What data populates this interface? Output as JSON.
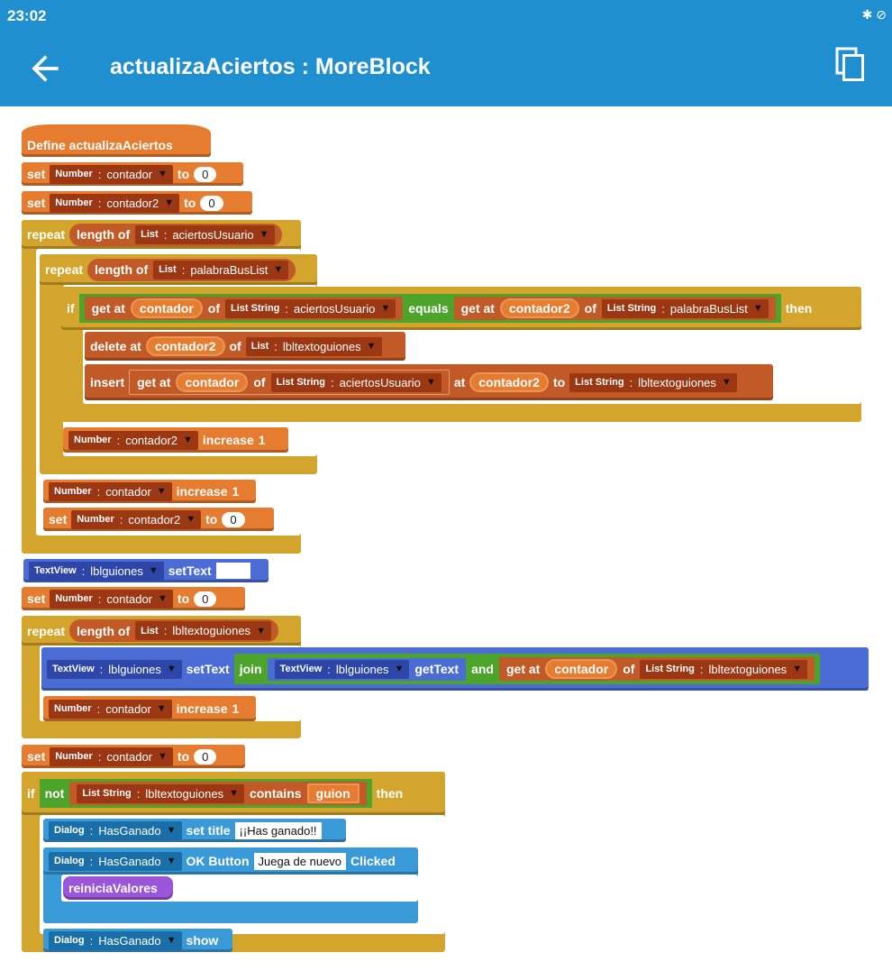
{
  "status": {
    "time": "23:02"
  },
  "appbar": {
    "title": "actualizaAciertos : MoreBlock",
    "back_icon": "arrow-left-icon",
    "copy_icon": "copy-icon"
  },
  "kw": {
    "define": "Define actualizaAciertos",
    "set": "set",
    "to": "to",
    "repeat": "repeat",
    "if": "if",
    "then": "then",
    "length_of": "length of",
    "get_at": "get at",
    "of": "of",
    "equals": "equals",
    "delete_at": "delete at",
    "insert": "insert",
    "at": "at",
    "increase": "increase",
    "set_text": "setText",
    "join": "join",
    "get_text": "getText",
    "and": "and",
    "not": "not",
    "contains": "contains",
    "set_title": "set title",
    "ok_button": "OK Button",
    "clicked": "Clicked",
    "show": "show"
  },
  "types": {
    "number": "Number",
    "list": "List",
    "list_string": "List String",
    "text_view": "TextView",
    "dialog": "Dialog"
  },
  "vars": {
    "contador": "contador",
    "contador2": "contador2",
    "aciertosUsuario": "aciertosUsuario",
    "palabraBusList": "palabraBusList",
    "lbltextoguiones": "lbltextoguiones",
    "lblguiones": "lblguiones",
    "HasGanado": "HasGanado",
    "guion": "guion"
  },
  "literals": {
    "zero": "0",
    "one": "1",
    "title_text": "¡¡Has ganado!!",
    "ok_text": "Juega de nuevo"
  },
  "procedure": {
    "reinicia": "reiniciaValores"
  },
  "colors": {
    "header": "#1f8fcf",
    "control": "#d4a52c",
    "variable": "#e57c2f",
    "list": "#c25a27",
    "view": "#4a6cd4",
    "string": "#4ca42a",
    "dialog": "#3a9ad8",
    "more_block": "#9b55d8"
  }
}
